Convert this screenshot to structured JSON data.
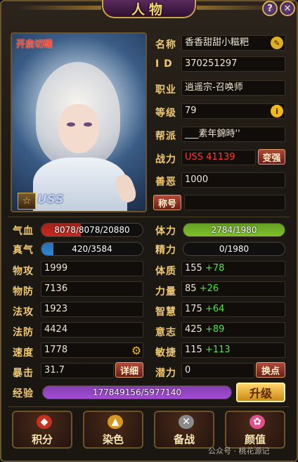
{
  "window": {
    "title": "人物",
    "help": "?",
    "close": "✕"
  },
  "portrait": {
    "cut_label": "开启切磋",
    "rank_icon": "☆",
    "rank_text": "USS"
  },
  "info": [
    {
      "label": "名称",
      "value": "香香甜甜小糍粑"
    },
    {
      "label": "I D",
      "value": "370251297"
    },
    {
      "label": "职业",
      "value": "逍遥宗-召唤师"
    },
    {
      "label": "等级",
      "value": "79"
    },
    {
      "label": "帮派",
      "value": "___素年錦時''"
    },
    {
      "label": "战力",
      "value": "USS  41139"
    },
    {
      "label": "善恶",
      "value": "1000"
    }
  ],
  "buttons": {
    "strengthen": "变强",
    "title_name": "称号",
    "detail": "详细",
    "exchange": "换点",
    "upgrade": "升级"
  },
  "bars": {
    "hp": {
      "label": "气血",
      "text": "8078/8078/20880",
      "fraction": 0.387,
      "color": "#c8281e"
    },
    "qi": {
      "label": "真气",
      "text": "420/3584",
      "fraction": 0.117,
      "color": "#2e86d8"
    },
    "stamina": {
      "label": "体力",
      "text": "2784/1980",
      "fraction": 1.0,
      "color": "#7cc22a"
    },
    "energy": {
      "label": "精力",
      "text": "0/1980",
      "fraction": 0.0,
      "color": "#6a6a6a"
    },
    "exp": {
      "label": "经验",
      "text": "177849156/5977140",
      "fraction": 1.0,
      "color": "#a34bd6"
    }
  },
  "left_stats": [
    {
      "label": "物攻",
      "value": "1999"
    },
    {
      "label": "物防",
      "value": "7136"
    },
    {
      "label": "法攻",
      "value": "1923"
    },
    {
      "label": "法防",
      "value": "4424"
    },
    {
      "label": "速度",
      "value": "1778"
    },
    {
      "label": "暴击",
      "value": "31.7"
    }
  ],
  "right_stats": [
    {
      "label": "体质",
      "value": "155",
      "bonus": "+78"
    },
    {
      "label": "力量",
      "value": "85",
      "bonus": "+26"
    },
    {
      "label": "智慧",
      "value": "175",
      "bonus": "+64"
    },
    {
      "label": "意志",
      "value": "425",
      "bonus": "+89"
    },
    {
      "label": "敏捷",
      "value": "115",
      "bonus": "+113"
    },
    {
      "label": "潜力",
      "value": "0",
      "bonus": ""
    }
  ],
  "bottom": [
    {
      "label": "积分",
      "icon": "money-bag-icon"
    },
    {
      "label": "染色",
      "icon": "dye-icon"
    },
    {
      "label": "备战",
      "icon": "battle-prep-icon"
    },
    {
      "label": "颜值",
      "icon": "lotus-icon"
    }
  ],
  "watermark": "公众号 · 桃花源记"
}
